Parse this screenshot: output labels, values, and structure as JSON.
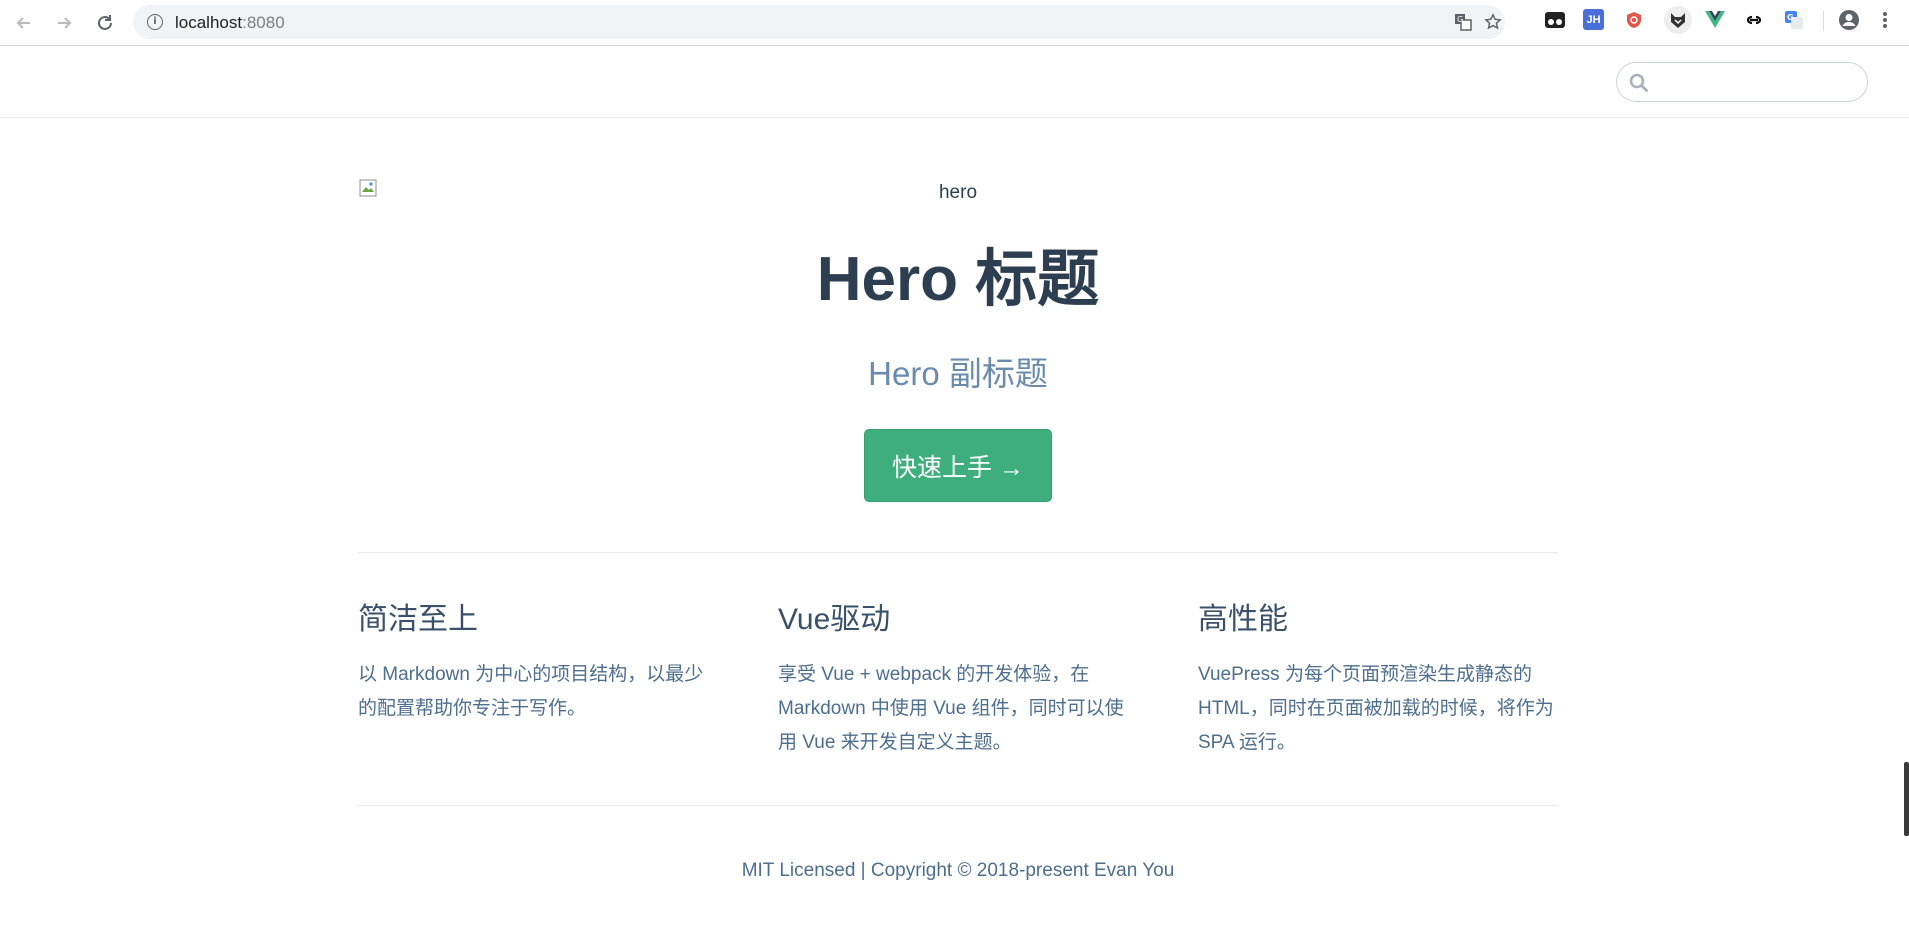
{
  "browser": {
    "url_host": "localhost",
    "url_port": ":8080",
    "extensions": [
      "tampermonkey-icon",
      "jh-extension-icon",
      "shield-extension-icon",
      "fox-extension-icon",
      "vue-devtools-icon",
      "link-extension-icon",
      "translate-extension-icon"
    ],
    "jh_label": "JH"
  },
  "hero": {
    "image_alt": "hero",
    "title": "Hero 标题",
    "subtitle": "Hero 副标题",
    "action_label": "快速上手 →"
  },
  "features": [
    {
      "title": "简洁至上",
      "details": "以 Markdown 为中心的项目结构，以最少的配置帮助你专注于写作。"
    },
    {
      "title": "Vue驱动",
      "details": "享受 Vue + webpack 的开发体验，在 Markdown 中使用 Vue 组件，同时可以使用 Vue 来开发自定义主题。"
    },
    {
      "title": "高性能",
      "details": "VuePress 为每个页面预渲染生成静态的 HTML，同时在页面被加载的时候，将作为 SPA 运行。"
    }
  ],
  "footer": "MIT Licensed | Copyright © 2018-present Evan You",
  "colors": {
    "accent": "#3eaf7c",
    "text": "#2c3e50",
    "subtitle": "#6a8bad",
    "body_text": "#4e6e8e",
    "border": "#eaecef"
  }
}
